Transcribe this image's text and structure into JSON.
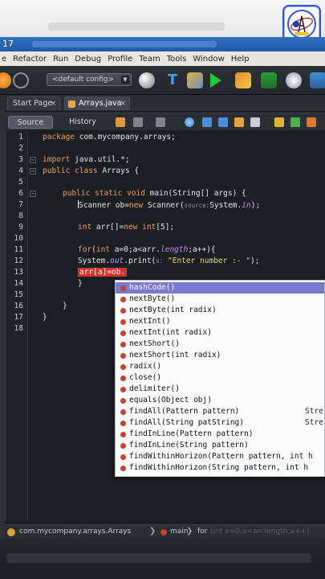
{
  "titlebar": {
    "text": "17"
  },
  "menubar": {
    "items": [
      "e",
      "Refactor",
      "Run",
      "Debug",
      "Profile",
      "Team",
      "Tools",
      "Window",
      "Help"
    ]
  },
  "toolbar": {
    "config_value": "<default config>"
  },
  "tabs": [
    {
      "label": "Start Page"
    },
    {
      "label": "Arrays.java"
    }
  ],
  "editor_toolbar": {
    "source_label": "Source",
    "history_label": "History"
  },
  "code": {
    "line_numbers": [
      "1",
      "2",
      "3",
      "4",
      "5",
      "6",
      "7",
      "8",
      "9",
      "10",
      "11",
      "12",
      "13",
      "14",
      "15",
      "16",
      "17",
      "18"
    ],
    "l1_kw": "package",
    "l1_rest": " com.mycompany.arrays;",
    "l3_kw": "import",
    "l3_rest": " java.util.*;",
    "l4_kw": "public class",
    "l4_rest": " Arrays {",
    "l6_kw": "public static void",
    "l6_rest": " main(String[] args) {",
    "l7_a": "Scanner ob=",
    "l7_kw": "new",
    "l7_b": " Scanner(",
    "l7_hint": "source:",
    "l7_c": "System.",
    "l7_fld": "in",
    "l7_d": ");",
    "l9_kw": "int",
    "l9_a": " arr[]=",
    "l9_kw2": "new",
    "l9_kw3": " int",
    "l9_b": "[5];",
    "l11_kw": "for",
    "l11_a": "(",
    "l11_kw2": "int",
    "l11_b": " a=0;a<arr.",
    "l11_fld": "length",
    "l11_c": ";a++){",
    "l12_a": "System.",
    "l12_fld": "out",
    "l12_b": ".print(",
    "l12_hint": "s:",
    "l12_str": " \"Enter number :- \"",
    "l12_c": ");",
    "l13_err": "arr[a]=ob.",
    "l14": "}",
    "l16": "}",
    "l17": "}"
  },
  "completion": {
    "items": [
      {
        "label": "hashCode()",
        "selected": true
      },
      {
        "label": "nextByte()"
      },
      {
        "label": "nextByte(int radix)"
      },
      {
        "label": "nextInt()"
      },
      {
        "label": "nextInt(int radix)"
      },
      {
        "label": "nextShort()"
      },
      {
        "label": "nextShort(int radix)"
      },
      {
        "label": "radix()"
      },
      {
        "label": "close()"
      },
      {
        "label": "delimiter()"
      },
      {
        "label": "equals(Object obj)"
      },
      {
        "label": "findAll(Pattern pattern)",
        "rtype": "Stre"
      },
      {
        "label": "findAll(String patString)",
        "rtype": "Stre"
      },
      {
        "label": "findInLine(Pattern pattern)"
      },
      {
        "label": "findInLine(String pattern)"
      },
      {
        "label": "findWithinHorizon(Pattern pattern, int h"
      },
      {
        "label": "findWithinHorizon(String pattern, int h"
      }
    ]
  },
  "statusbar": {
    "crumb1": "com.mycompany.arrays.Arrays",
    "crumb2": "main",
    "crumb3": "for",
    "crumb3_faded": "(int a=0;a<arr.length;a++)"
  },
  "colors": {
    "accent": "#7a78cf",
    "error": "#d8322f",
    "keyword": "#f0a05a"
  }
}
